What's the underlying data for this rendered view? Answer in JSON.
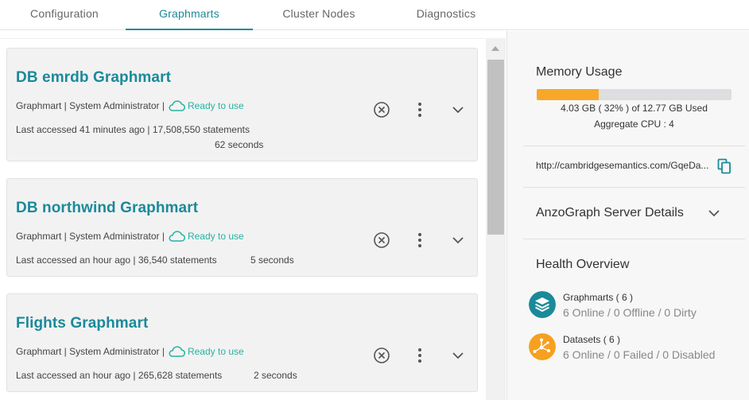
{
  "tabs": [
    {
      "label": "Configuration"
    },
    {
      "label": "Graphmarts"
    },
    {
      "label": "Cluster Nodes"
    },
    {
      "label": "Diagnostics"
    }
  ],
  "cards": [
    {
      "title": "DB emrdb Graphmart",
      "meta": "Graphmart | System Administrator |",
      "status": "Ready to use",
      "access": "Last accessed 41 minutes ago | 17,508,550 statements",
      "duration": "62 seconds"
    },
    {
      "title": "DB northwind Graphmart",
      "meta": "Graphmart | System Administrator |",
      "status": "Ready to use",
      "access": "Last accessed an hour ago | 36,540 statements",
      "duration": "5 seconds"
    },
    {
      "title": "Flights Graphmart",
      "meta": "Graphmart | System Administrator |",
      "status": "Ready to use",
      "access": "Last accessed an hour ago | 265,628 statements",
      "duration": "2 seconds"
    }
  ],
  "memory": {
    "title": "Memory Usage",
    "percent_used": 32,
    "usage_text": "4.03 GB ( 32% ) of 12.77 GB Used",
    "cpu_text": "Aggregate CPU : 4"
  },
  "server_url": "http://cambridgesemantics.com/GqeDa...",
  "server_details_label": "AnzoGraph Server Details",
  "health": {
    "title": "Health Overview",
    "graphmarts_label": "Graphmarts ( 6 )",
    "graphmarts_status": "6 Online / 0 Offline / 0 Dirty",
    "datasets_label": "Datasets ( 6 )",
    "datasets_status": "6 Online / 0 Failed / 0 Disabled"
  },
  "colors": {
    "accent": "#1a8a9a",
    "ready": "#26b3a0",
    "memory_bar": "#f7a82a",
    "graphmarts_icon": "#1a8a9a",
    "datasets_icon": "#f7a020"
  }
}
